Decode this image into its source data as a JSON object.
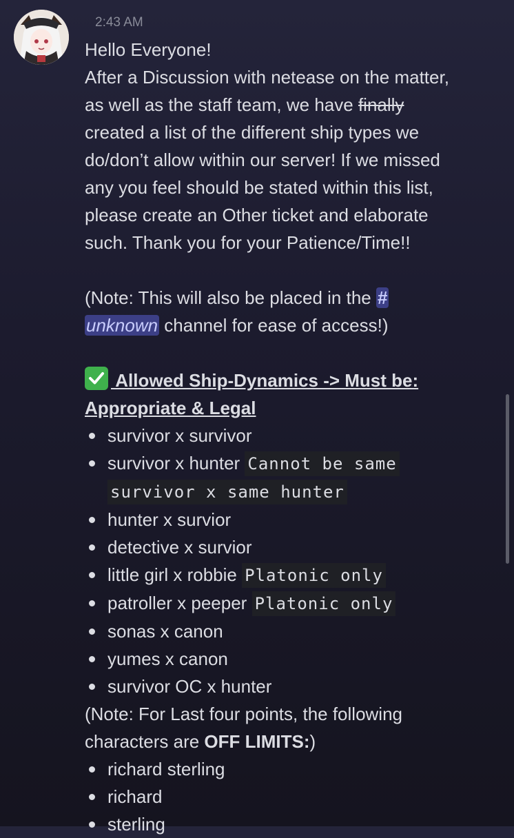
{
  "message": {
    "timestamp": "2:43 AM",
    "greeting": "Hello Everyone!",
    "intro_lines": [
      "After a Discussion with netease on the matter,",
      "as well as the staff team, we have ",
      "created a list of the different ship types we",
      "do/don’t allow within our server! If we missed",
      "any you feel should be stated within this list,",
      "please create an Other ticket and elaborate",
      "such. Thank you for your Patience/Time!!"
    ],
    "struck_word": "finally",
    "note_prefix": "(Note: This will also be placed in the ",
    "channel_hash": "#",
    "channel_name": "unknown",
    "note_suffix": " channel for ease of access!)",
    "allowed_heading_line1": " Allowed Ship-Dynamics -> Must be:",
    "allowed_heading_line2": "Appropriate & Legal",
    "allowed_items": [
      {
        "text": "survivor x survivor",
        "code": ""
      },
      {
        "text": "survivor x hunter ",
        "code": "Cannot be same survivor x same hunter"
      },
      {
        "text": "hunter x survior",
        "code": ""
      },
      {
        "text": "detective x survior",
        "code": ""
      },
      {
        "text": "little girl x robbie ",
        "code": "Platonic only"
      },
      {
        "text": "patroller x peeper ",
        "code": "Platonic only"
      },
      {
        "text": "sonas x canon",
        "code": ""
      },
      {
        "text": "yumes x canon",
        "code": ""
      },
      {
        "text": "survivor OC x hunter",
        "code": ""
      }
    ],
    "offlimits_note_line1": "(Note: For Last four points, the following",
    "offlimits_note_prefix": "characters are ",
    "offlimits_bold": "OFF LIMITS:",
    "offlimits_suffix": ")",
    "offlimits_items": [
      "richard sterling",
      "richard",
      "sterling"
    ]
  },
  "colors": {
    "channel_mention_bg": "#3c3f86",
    "check_emoji": "#3fb14c"
  },
  "icons": [
    "avatar-image",
    "check-mark-emoji-icon"
  ]
}
